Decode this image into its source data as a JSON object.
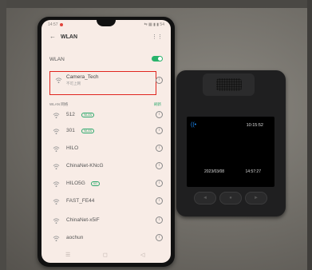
{
  "status_bar": {
    "time": "14:57",
    "right": "⇆ ▦ ▮ ▮ 54"
  },
  "header": {
    "title": "WLAN",
    "menu_icon": "⋮⋮",
    "back_icon": "arrow-left-icon"
  },
  "wlan_toggle": {
    "label": "WLAN",
    "on": true,
    "color": "#29b36b"
  },
  "connected_network": {
    "ssid": "Camera_Tech",
    "sub": "不可上网"
  },
  "section_label": "WLAN 网络",
  "section_right": "刷新",
  "networks": [
    {
      "ssid": "512",
      "badge": "WLAN"
    },
    {
      "ssid": "301",
      "badge": "WLAN"
    },
    {
      "ssid": "HILO",
      "badge": ""
    },
    {
      "ssid": "ChinaNet-KNcG",
      "badge": ""
    },
    {
      "ssid": "HILO5G",
      "badge": "5G"
    },
    {
      "ssid": "FAST_FE44",
      "badge": ""
    },
    {
      "ssid": "ChinaNet-x5iF",
      "badge": ""
    },
    {
      "ssid": "aochun",
      "badge": ""
    }
  ],
  "nav": {
    "menu": "☰",
    "home": "◻",
    "back": "◁"
  },
  "camera": {
    "time_top": "10:15:52",
    "date": "2023/03/08",
    "time_bottom": "14:57:27"
  },
  "highlight_color": "#e0251e"
}
